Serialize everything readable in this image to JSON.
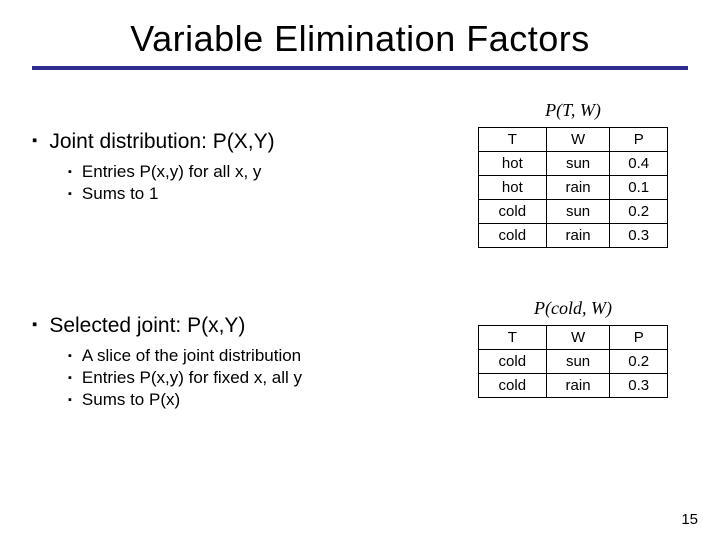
{
  "title": "Variable Elimination Factors",
  "left": {
    "section1": {
      "head": "Joint distribution: P(X,Y)",
      "items": [
        "Entries P(x,y) for all x, y",
        "Sums to 1"
      ]
    },
    "section2": {
      "head": "Selected joint: P(x,Y)",
      "items": [
        "A slice of the joint distribution",
        "Entries P(x,y) for fixed x, all y",
        "Sums to P(x)"
      ]
    }
  },
  "right": {
    "formula1": "P(T, W)",
    "formula2": "P(cold, W)"
  },
  "chart_data": [
    {
      "type": "table",
      "title": "P(T,W)",
      "columns": [
        "T",
        "W",
        "P"
      ],
      "rows": [
        [
          "hot",
          "sun",
          "0.4"
        ],
        [
          "hot",
          "rain",
          "0.1"
        ],
        [
          "cold",
          "sun",
          "0.2"
        ],
        [
          "cold",
          "rain",
          "0.3"
        ]
      ]
    },
    {
      "type": "table",
      "title": "P(cold,W)",
      "columns": [
        "T",
        "W",
        "P"
      ],
      "rows": [
        [
          "cold",
          "sun",
          "0.2"
        ],
        [
          "cold",
          "rain",
          "0.3"
        ]
      ]
    }
  ],
  "pagenum": "15"
}
